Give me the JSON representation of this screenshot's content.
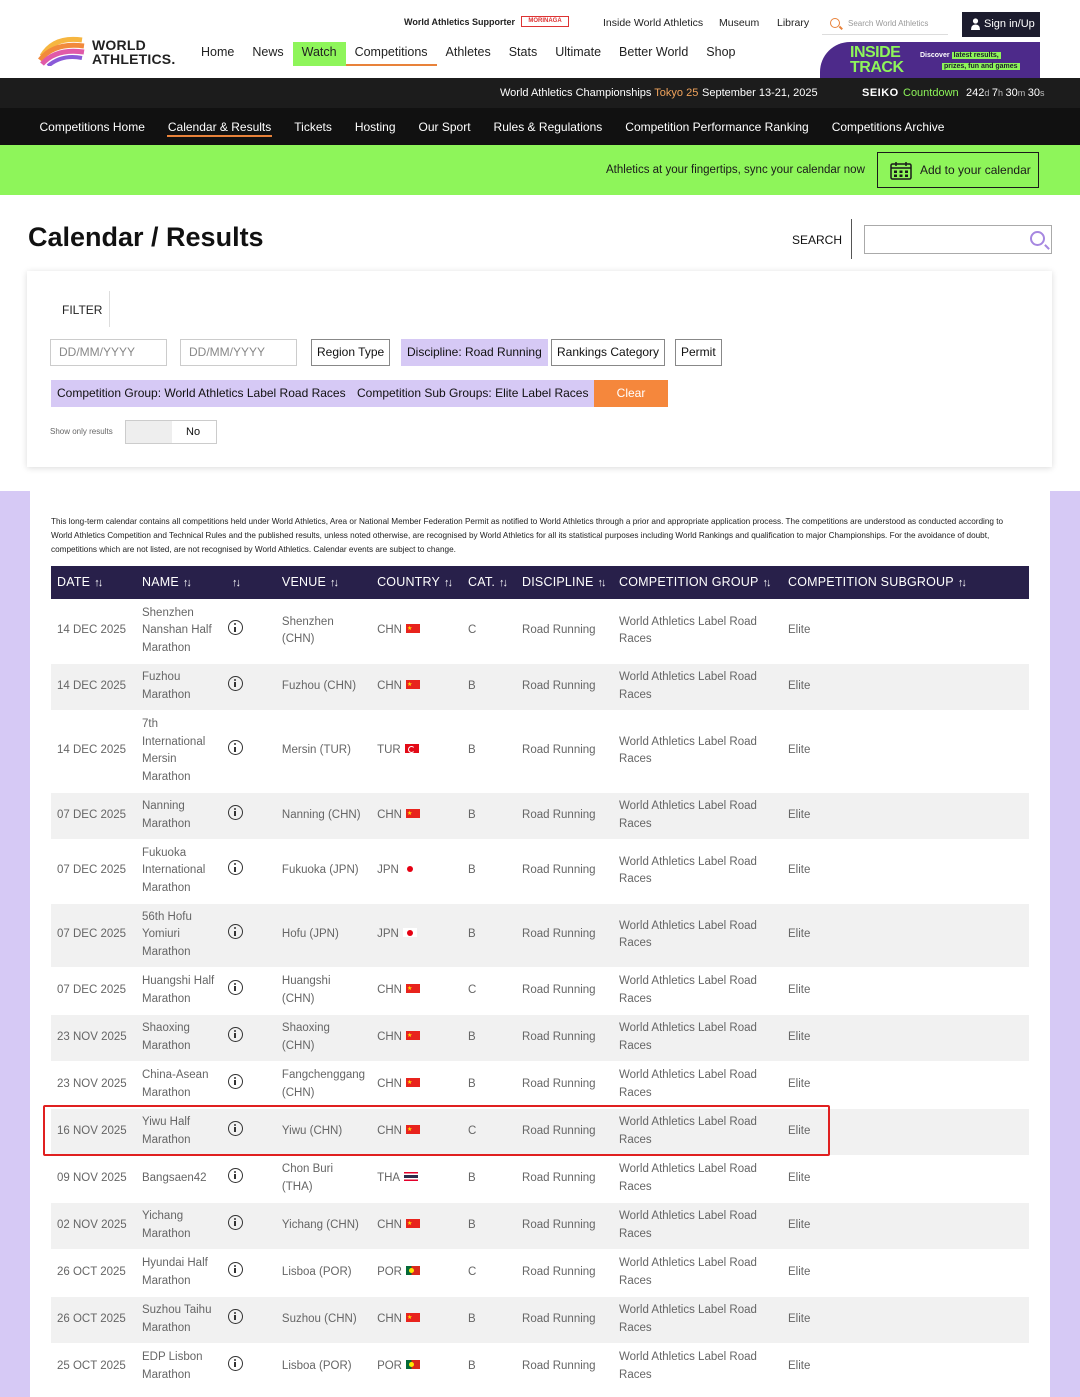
{
  "header": {
    "logo_text_line1": "WORLD",
    "logo_text_line2": "ATHLETICS.",
    "supporter": "World Athletics Supporter",
    "supporter_brand": "MORINAGA",
    "util_links": [
      "Inside World Athletics",
      "Museum",
      "Library"
    ],
    "search_placeholder": "Search World Athletics",
    "signin": "Sign in/Up",
    "main_nav": [
      "Home",
      "News",
      "Watch",
      "Competitions",
      "Athletes",
      "Stats",
      "Ultimate",
      "Better World",
      "Shop"
    ],
    "inside_track": {
      "title_line1": "INSIDE",
      "title_line2": "TRACK",
      "discover": "Discover",
      "highlight1": "latest results,",
      "highlight2": "prizes, fun and games"
    }
  },
  "countdown": {
    "event": "World Athletics Championships",
    "city": "Tokyo 25",
    "dates": "September 13-21, 2025",
    "brand": "SEIKO",
    "label": "Countdown",
    "days": "242",
    "hours": "7",
    "minutes": "30",
    "seconds": "30"
  },
  "subnav": [
    "Competitions Home",
    "Calendar & Results",
    "Tickets",
    "Hosting",
    "Our Sport",
    "Rules & Regulations",
    "Competition Performance Ranking",
    "Competitions Archive"
  ],
  "calendar_bar": {
    "message": "Athletics at your fingertips, sync your calendar now",
    "button": "Add to your calendar"
  },
  "page": {
    "title": "Calendar / Results",
    "search_label": "SEARCH"
  },
  "filter": {
    "label": "FILTER",
    "date_from_placeholder": "DD/MM/YYYY",
    "date_to_placeholder": "DD/MM/YYYY",
    "region_type": "Region Type",
    "discipline": "Discipline: Road Running",
    "rankings_category": "Rankings Category",
    "permit": "Permit",
    "competition_group": "Competition Group: World Athletics Label Road Races",
    "competition_sub_groups": "Competition Sub Groups: Elite Label Races",
    "clear": "Clear",
    "show_only_results_label": "Show only results",
    "show_only_results_value": "No"
  },
  "disclaimer": "This long-term calendar contains all competitions held under World Athletics, Area or National Member Federation Permit as notified to World Athletics through a prior and appropriate application process. The competitions are understood as conducted according to World Athletics Competition and Technical Rules and the published results, unless noted otherwise, are recognised by World Athletics for all its statistical purposes including World Rankings and qualification to major Championships. For the avoidance of doubt, competitions which are not listed, are not recognised by World Athletics. Calendar events are subject to change.",
  "table": {
    "columns": [
      "DATE",
      "NAME",
      "",
      "VENUE",
      "COUNTRY",
      "CAT.",
      "DISCIPLINE",
      "COMPETITION GROUP",
      "COMPETITION SUBGROUP"
    ],
    "rows": [
      {
        "date": "14 DEC 2025",
        "name": "Shenzhen Nanshan Half Marathon",
        "venue": "Shenzhen (CHN)",
        "country": "CHN",
        "cat": "C",
        "discipline": "Road Running",
        "group": "World Athletics Label Road Races",
        "subgroup": "Elite"
      },
      {
        "date": "14 DEC 2025",
        "name": "Fuzhou Marathon",
        "venue": "Fuzhou (CHN)",
        "country": "CHN",
        "cat": "B",
        "discipline": "Road Running",
        "group": "World Athletics Label Road Races",
        "subgroup": "Elite"
      },
      {
        "date": "14 DEC 2025",
        "name": "7th International Mersin Marathon",
        "venue": "Mersin (TUR)",
        "country": "TUR",
        "cat": "B",
        "discipline": "Road Running",
        "group": "World Athletics Label Road Races",
        "subgroup": "Elite"
      },
      {
        "date": "07 DEC 2025",
        "name": "Nanning Marathon",
        "venue": "Nanning (CHN)",
        "country": "CHN",
        "cat": "B",
        "discipline": "Road Running",
        "group": "World Athletics Label Road Races",
        "subgroup": "Elite"
      },
      {
        "date": "07 DEC 2025",
        "name": "Fukuoka International Marathon",
        "venue": "Fukuoka (JPN)",
        "country": "JPN",
        "cat": "B",
        "discipline": "Road Running",
        "group": "World Athletics Label Road Races",
        "subgroup": "Elite"
      },
      {
        "date": "07 DEC 2025",
        "name": "56th Hofu Yomiuri Marathon",
        "venue": "Hofu (JPN)",
        "country": "JPN",
        "cat": "B",
        "discipline": "Road Running",
        "group": "World Athletics Label Road Races",
        "subgroup": "Elite"
      },
      {
        "date": "07 DEC 2025",
        "name": "Huangshi Half Marathon",
        "venue": "Huangshi (CHN)",
        "country": "CHN",
        "cat": "C",
        "discipline": "Road Running",
        "group": "World Athletics Label Road Races",
        "subgroup": "Elite"
      },
      {
        "date": "23 NOV 2025",
        "name": "Shaoxing Marathon",
        "venue": "Shaoxing (CHN)",
        "country": "CHN",
        "cat": "B",
        "discipline": "Road Running",
        "group": "World Athletics Label Road Races",
        "subgroup": "Elite"
      },
      {
        "date": "23 NOV 2025",
        "name": "China-Asean Marathon",
        "venue": "Fangchenggang (CHN)",
        "country": "CHN",
        "cat": "B",
        "discipline": "Road Running",
        "group": "World Athletics Label Road Races",
        "subgroup": "Elite"
      },
      {
        "date": "16 NOV 2025",
        "name": "Yiwu Half Marathon",
        "venue": "Yiwu (CHN)",
        "country": "CHN",
        "cat": "C",
        "discipline": "Road Running",
        "group": "World Athletics Label Road Races",
        "subgroup": "Elite"
      },
      {
        "date": "09 NOV 2025",
        "name": "Bangsaen42",
        "venue": "Chon Buri (THA)",
        "country": "THA",
        "cat": "B",
        "discipline": "Road Running",
        "group": "World Athletics Label Road Races",
        "subgroup": "Elite"
      },
      {
        "date": "02 NOV 2025",
        "name": "Yichang Marathon",
        "venue": "Yichang (CHN)",
        "country": "CHN",
        "cat": "B",
        "discipline": "Road Running",
        "group": "World Athletics Label Road Races",
        "subgroup": "Elite"
      },
      {
        "date": "26 OCT 2025",
        "name": "Hyundai Half Marathon",
        "venue": "Lisboa (POR)",
        "country": "POR",
        "cat": "C",
        "discipline": "Road Running",
        "group": "World Athletics Label Road Races",
        "subgroup": "Elite"
      },
      {
        "date": "26 OCT 2025",
        "name": "Suzhou Taihu Marathon",
        "venue": "Suzhou (CHN)",
        "country": "CHN",
        "cat": "B",
        "discipline": "Road Running",
        "group": "World Athletics Label Road Races",
        "subgroup": "Elite"
      },
      {
        "date": "25 OCT 2025",
        "name": "EDP Lisbon Marathon",
        "venue": "Lisboa (POR)",
        "country": "POR",
        "cat": "B",
        "discipline": "Road Running",
        "group": "World Athletics Label Road Races",
        "subgroup": "Elite"
      }
    ]
  }
}
